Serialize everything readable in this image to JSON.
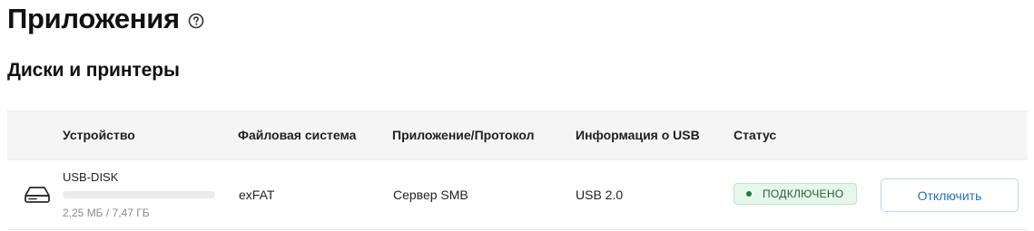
{
  "page": {
    "title": "Приложения",
    "help_icon": "question-circle-icon"
  },
  "section": {
    "title": "Диски и принтеры"
  },
  "table": {
    "columns": [
      "Устройство",
      "Файловая система",
      "Приложение/Протокол",
      "Информация о USB",
      "Статус"
    ],
    "rows": [
      {
        "icon": "hard-drive-icon",
        "device_name": "USB-DISK",
        "usage_text": "2,25 МБ / 7,47 ГБ",
        "usage_fraction": 0.0003,
        "filesystem": "exFAT",
        "protocol": "Сервер SMB",
        "usb_info": "USB 2.0",
        "status": "ПОДКЛЮЧЕНО",
        "action_label": "Отключить"
      }
    ]
  },
  "colors": {
    "accent": "#1f6fbf",
    "status_bg": "#e6f6ec",
    "status_dot": "#1e7a44",
    "header_bg": "#f5f5f5"
  }
}
